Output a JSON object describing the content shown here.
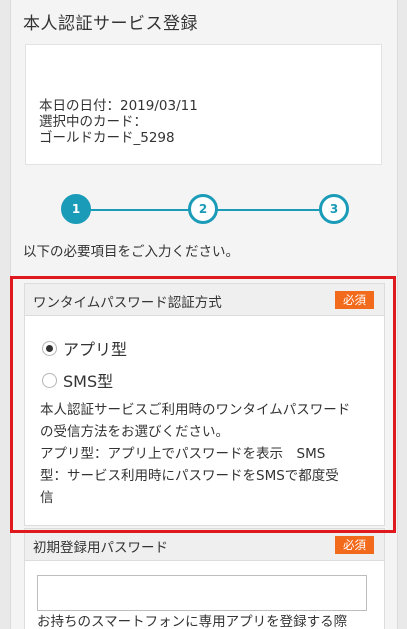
{
  "page": {
    "title": "本人認証サービス登録"
  },
  "info": {
    "date_line": "本日の日付：2019/03/11",
    "card_label": "選択中のカード：",
    "card_name": "ゴールドカード_5298"
  },
  "stepper": {
    "steps": [
      "1",
      "2",
      "3"
    ],
    "current": 1
  },
  "instruction": "以下の必要項目をご入力ください。",
  "otp_section": {
    "title": "ワンタイムパスワード認証方式",
    "badge": "必須",
    "options": [
      {
        "label": "アプリ型",
        "checked": true
      },
      {
        "label": "SMS型",
        "checked": false
      }
    ],
    "description_lines": [
      "本人認証サービスご利用時のワンタイムパスワード",
      "の受信方法をお選びください。",
      "アプリ型：アプリ上でパスワードを表示　SMS",
      "型：サービス利用時にパスワードをSMSで都度受",
      "信"
    ]
  },
  "password_section": {
    "title": "初期登録用パスワード",
    "badge": "必須",
    "input_value": "",
    "description": "お持ちのスマートフォンに専用アプリを登録する際"
  },
  "colors": {
    "accent": "#1a9bb8",
    "badge": "#f26b1d",
    "highlight": "#e0191e"
  }
}
